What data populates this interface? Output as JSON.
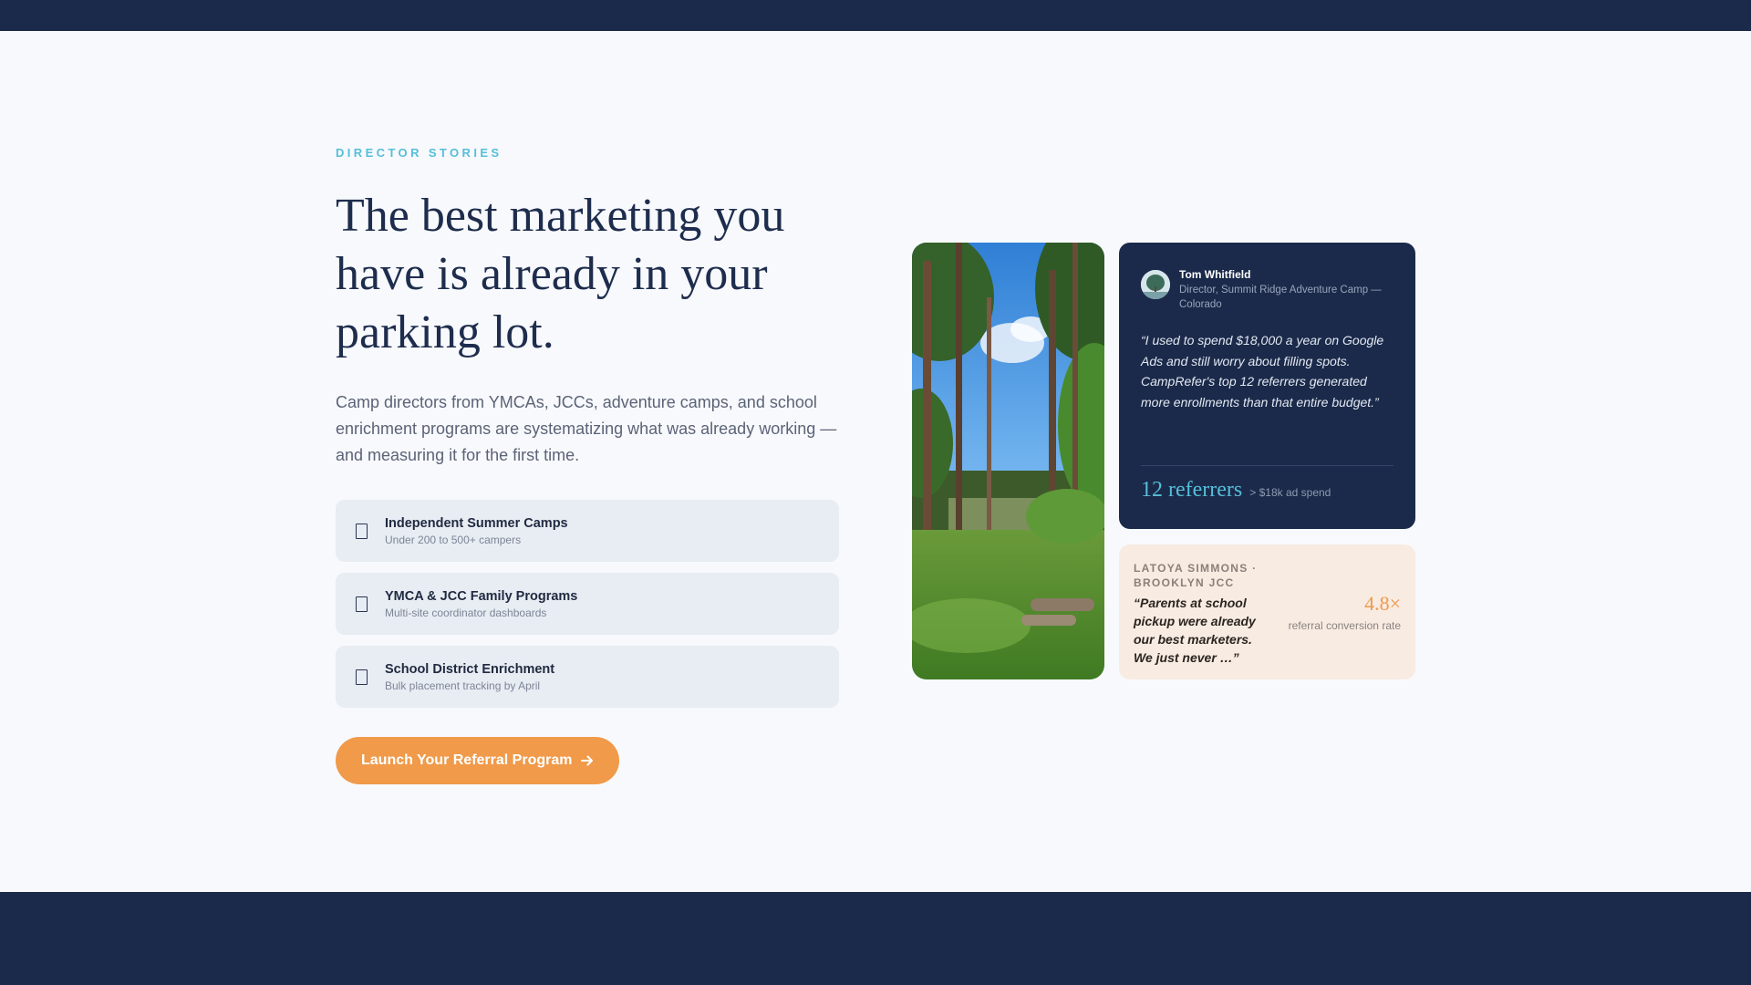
{
  "section": {
    "eyebrow": "DIRECTOR STORIES",
    "headline": "The best marketing you have is already in your parking lot.",
    "subcopy": "Camp directors from YMCAs, JCCs, adventure camps, and school enrichment programs are systematizing what was already working — and measuring it for the first time."
  },
  "options": [
    {
      "title": "Independent Summer Camps",
      "subtitle": "Under 200 to 500+ campers",
      "checked": false
    },
    {
      "title": "YMCA & JCC Family Programs",
      "subtitle": "Multi-site coordinator dashboards",
      "checked": false
    },
    {
      "title": "School District Enrichment",
      "subtitle": "Bulk placement tracking by April",
      "checked": false
    }
  ],
  "cta": {
    "label": "Launch Your Referral Program",
    "icon": "arrow-right-icon"
  },
  "testimonial_primary": {
    "name": "Tom Whitfield",
    "role": "Director, Summit Ridge Adventure Camp — Colorado",
    "quote": "“I used to spend $18,000 a year on Google Ads and still worry about filling spots. CampRefer's top 12 referrers generated more enrollments than that entire budget.”",
    "stat": "12 referrers",
    "stat_note": "> $18k ad spend"
  },
  "testimonial_secondary": {
    "name": "LATOYA SIMMONS · BROOKLYN JCC",
    "quote": "“Parents at school pickup were already our best marketers. We just never …”",
    "stat": "4.8×",
    "stat_label": "referral conversion rate"
  },
  "colors": {
    "navy": "#1b2a4a",
    "accent_orange": "#f09a4a",
    "accent_teal": "#55bfd9",
    "page_bg": "#f8f9fc",
    "option_bg": "#e8ecf3",
    "card_light_bg": "#f8ebe2"
  }
}
